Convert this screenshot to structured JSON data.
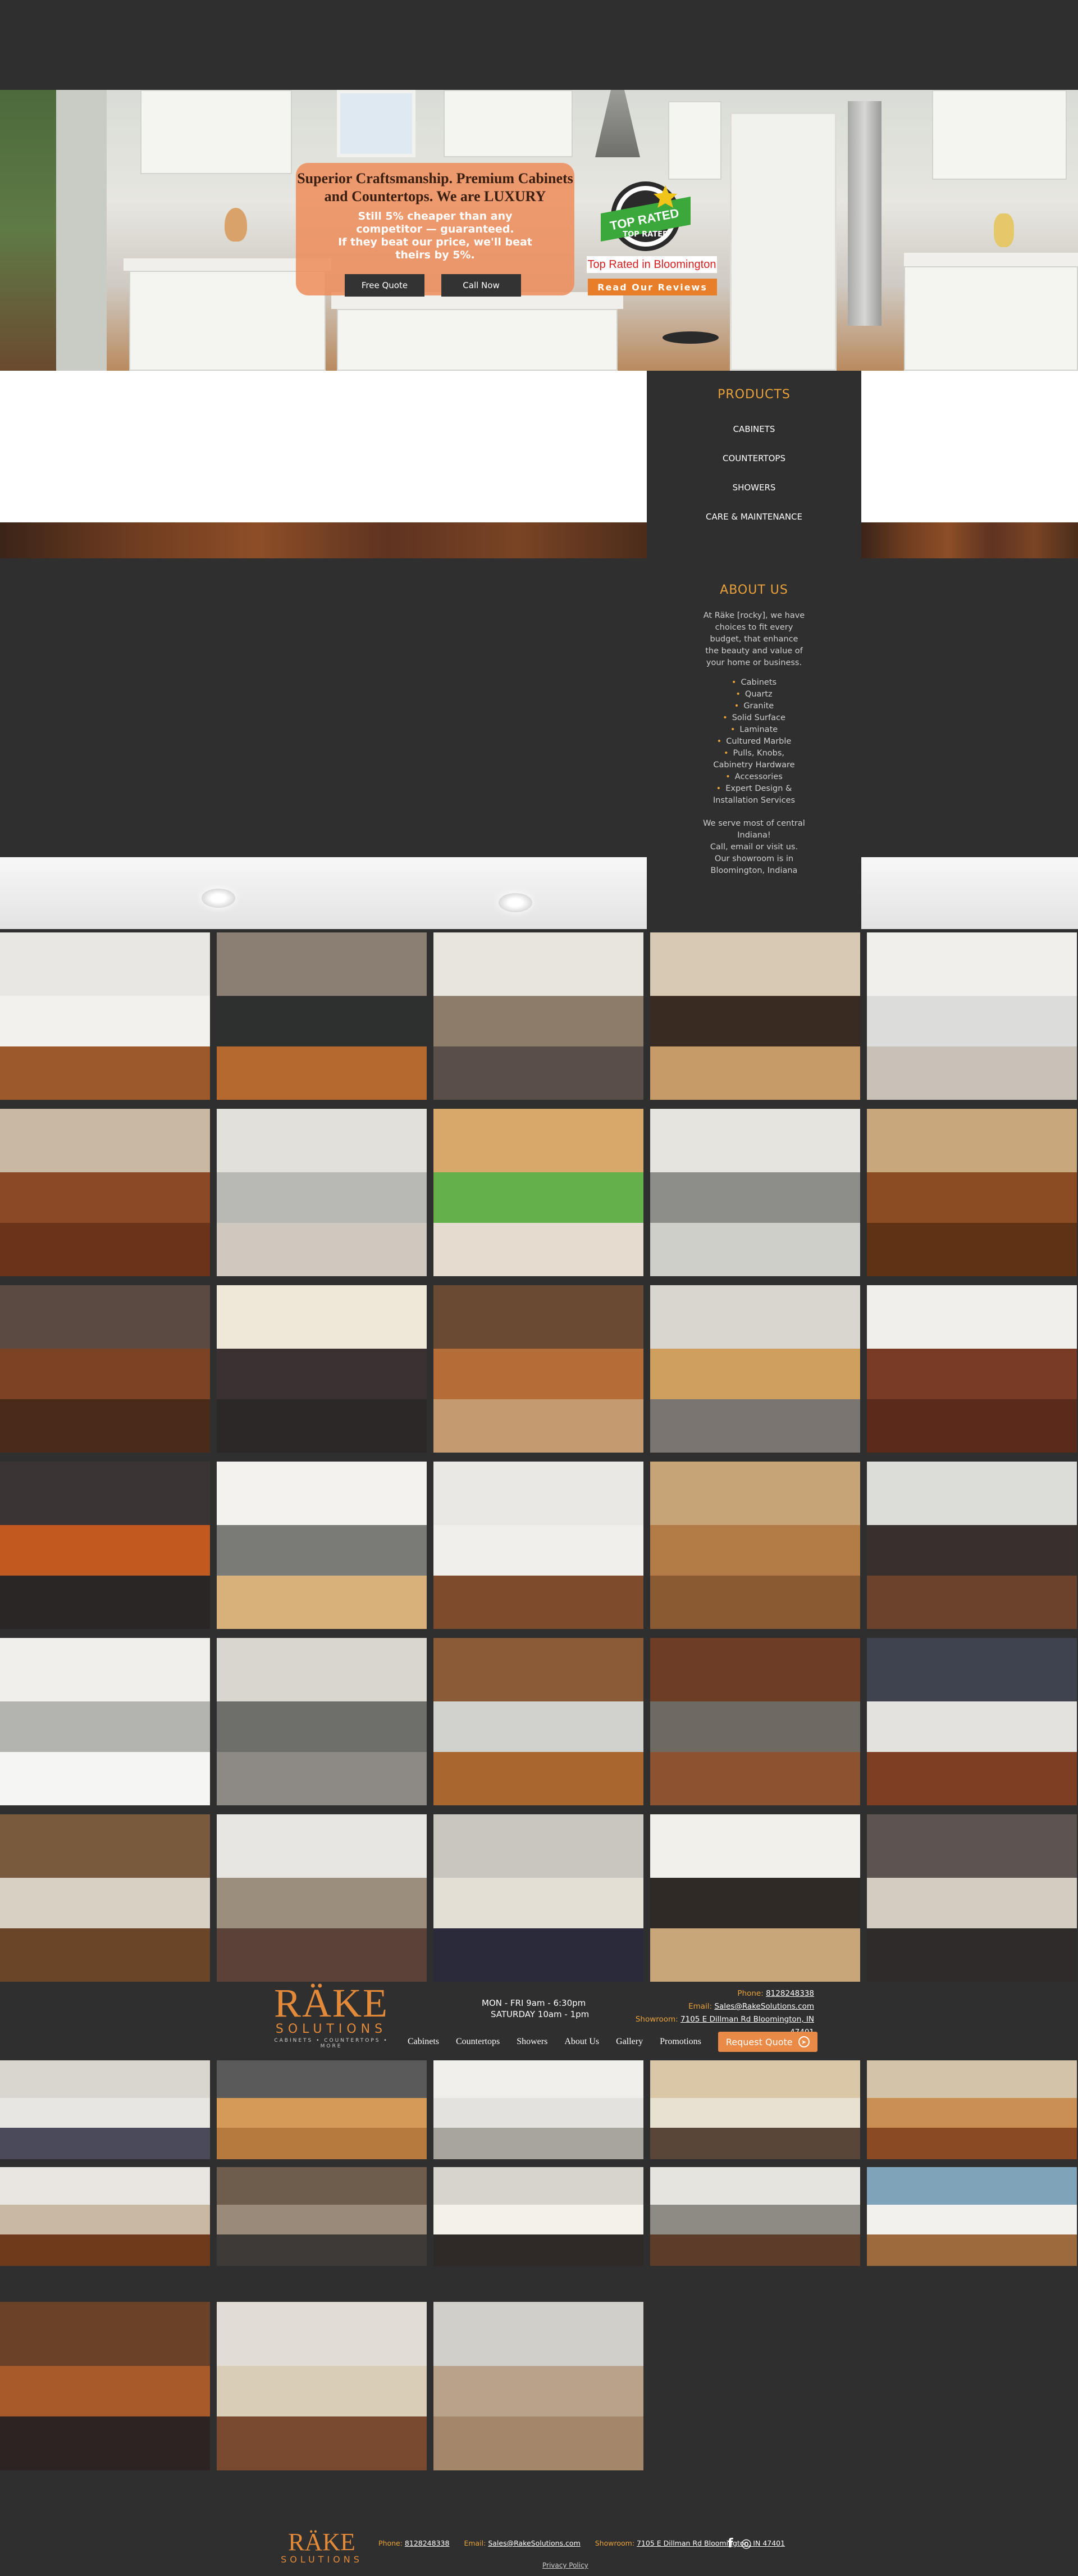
{
  "hero": {
    "headline_line1": "Superior Craftsmanship.  Premium Cabinets",
    "headline_line2": "and Countertops.  We are LUXURY",
    "sub_line1": "Still 5% cheaper than any",
    "sub_line2": "competitor — guaranteed.",
    "sub_line3": "If they beat our price, we'll beat",
    "sub_line4": "theirs by 5%.",
    "free_quote_label": "Free Quote",
    "call_now_label": "Call Now",
    "badge_text_top": "TOP RATED",
    "badge_text_bottom": "TOP RATED",
    "top_rated_label": "Top Rated in Bloomington",
    "reviews_label": "Read Our Reviews"
  },
  "products": {
    "heading": "PRODUCTS",
    "items": [
      "CABINETS",
      "COUNTERTOPS",
      "SHOWERS",
      "CARE & MAINTENANCE"
    ]
  },
  "about": {
    "heading": "ABOUT US",
    "intro": "At Räke [rocky], we have choices to fit every budget, that enhance the beauty and value of your home or business.",
    "list": [
      "Cabinets",
      "Quartz",
      "Granite",
      "Solid Surface",
      "Laminate",
      "Cultured Marble",
      "Pulls, Knobs,"
    ],
    "hardware_line": "Cabinetry Hardware",
    "list2": [
      "Accessories",
      "Expert Design &"
    ],
    "install_line": "Installation Services",
    "serve_line1": "We serve most of central",
    "serve_line2": "Indiana!",
    "serve_line3": "Call, email or visit us.",
    "serve_line4": "Our showroom is in",
    "serve_line5": "Bloomington, Indiana"
  },
  "footer": {
    "logo_text": "RÄKE",
    "logo_sub": "SOLUTIONS",
    "logo_tag": "CABINETS • COUNTERTOPS • MORE",
    "hours_line1": "MON - FRI   9am - 6:30pm",
    "hours_line2": "SATURDAY  10am - 1pm",
    "phone_label": "Phone:",
    "phone_value": "8128248338",
    "email_label": "Email:",
    "email_value": "Sales@RakeSolutions.com",
    "showroom_label": "Showroom:",
    "showroom_value": "7105 E Dillman Rd Bloomington, IN 47401",
    "nav": [
      "Cabinets",
      "Countertops",
      "Showers",
      "About Us",
      "Gallery",
      "Promotions"
    ],
    "request_quote_label": "Request Quote"
  },
  "bottom": {
    "logo_text": "RÄKE",
    "logo_sub": "SOLUTIONS",
    "phone_label": "Phone:",
    "phone_value": "8128248338",
    "email_label": "Email:",
    "email_value": "Sales@RakeSolutions.com",
    "showroom_label": "Showroom:",
    "showroom_value": "7105 E Dillman Rd Bloomington, IN 47401",
    "privacy_label": "Privacy Policy",
    "social": [
      "f",
      "◎"
    ]
  },
  "colors": {
    "background": "#2f2f2f",
    "accent": "#e9a23b",
    "brand_orange": "#e28a3a",
    "promo_box": "#ee8c5a",
    "reviews_button": "#e87e2a"
  },
  "gallery_tiles": [
    {
      "top": "#e9e7e3",
      "mid": "#f2f1ee",
      "bottom": "#9c5a2c"
    },
    {
      "top": "#8a7f72",
      "mid": "#2e2f2f",
      "bottom": "#b5692f"
    },
    {
      "top": "#e8e5df",
      "mid": "#8e7c6a",
      "bottom": "#5a4f48"
    },
    {
      "top": "#d8c9b3",
      "mid": "#3a2b22",
      "bottom": "#c79b68"
    },
    {
      "top": "#f0efec",
      "mid": "#dcdcda",
      "bottom": "#c7c1b8"
    },
    {
      "top": "#c9b9a3",
      "mid": "#8b4a25",
      "bottom": "#6b3319"
    },
    {
      "top": "#e2e0db",
      "mid": "#b8b8b4",
      "bottom": "#cfc8bf"
    },
    {
      "top": "#d8a86a",
      "mid": "#64b04a",
      "bottom": "#e5dbcf"
    },
    {
      "top": "#e6e4df",
      "mid": "#8d8d89",
      "bottom": "#cfcfc9"
    },
    {
      "top": "#c8a77c",
      "mid": "#8b4c22",
      "bottom": "#5f3115"
    },
    {
      "top": "#5a4a42",
      "mid": "#7b4324",
      "bottom": "#4a2a18"
    },
    {
      "top": "#efe8d8",
      "mid": "#3a3232",
      "bottom": "#2d2828"
    },
    {
      "top": "#6b4a34",
      "mid": "#b46d36",
      "bottom": "#c49b70"
    },
    {
      "top": "#d9d6d0",
      "mid": "#cf9f5e",
      "bottom": "#7a7570"
    },
    {
      "top": "#f0efec",
      "mid": "#7a3b26",
      "bottom": "#5b2a1a"
    },
    {
      "top": "#3a3434",
      "mid": "#c25a20",
      "bottom": "#2a2626"
    },
    {
      "top": "#f3f2ef",
      "mid": "#7a7a76",
      "bottom": "#d8b07a"
    },
    {
      "top": "#e9e8e4",
      "mid": "#f0efec",
      "bottom": "#7e4b2c"
    },
    {
      "top": "#c7a378",
      "mid": "#b37b46",
      "bottom": "#8a5a32"
    },
    {
      "top": "#dcdcd9",
      "mid": "#38302d",
      "bottom": "#6b432c"
    },
    {
      "top": "#f0efec",
      "mid": "#b3b3b0",
      "bottom": "#f5f5f3"
    },
    {
      "top": "#d9d6d0",
      "mid": "#6e6e6b",
      "bottom": "#8d8a85"
    },
    {
      "top": "#8b5a36",
      "mid": "#d1d1cd",
      "bottom": "#a9662e"
    },
    {
      "top": "#6d3e25",
      "mid": "#6e6a62",
      "bottom": "#8b5330"
    },
    {
      "top": "#3f4350",
      "mid": "#e3e2de",
      "bottom": "#7d3e24"
    },
    {
      "top": "#7a5a3c",
      "mid": "#d8d0c3",
      "bottom": "#6b4528"
    },
    {
      "top": "#e8e6e2",
      "mid": "#9c8e7c",
      "bottom": "#5a4238"
    },
    {
      "top": "#c9c5bf",
      "mid": "#e4dfd5",
      "bottom": "#2a2a3a"
    },
    {
      "top": "#f2f0eb",
      "mid": "#2f2a26",
      "bottom": "#c9a57a"
    },
    {
      "top": "#5b5450",
      "mid": "#d3ccc0",
      "bottom": "#2f2b2a"
    }
  ],
  "bottom_tiles": [
    {
      "top": "#d9d6d0",
      "mid": "#e8e6e2",
      "bottom": "#4a4a5a"
    },
    {
      "top": "#5a5a5a",
      "mid": "#d59a58",
      "bottom": "#b67a3e"
    },
    {
      "top": "#f0efec",
      "mid": "#e4e2de",
      "bottom": "#a8a49e"
    },
    {
      "top": "#d9c7a8",
      "mid": "#e8e0d0",
      "bottom": "#5a4638"
    },
    {
      "top": "#d3c3a8",
      "mid": "#c98f55",
      "bottom": "#8a4a23"
    },
    {
      "top": "#e9e6e1",
      "mid": "#c9b9a3",
      "bottom": "#6f3a1c"
    },
    {
      "top": "#6e5d4c",
      "mid": "#9a8a7a",
      "bottom": "#3e3a38"
    },
    {
      "top": "#d7d4ce",
      "mid": "#f3f1ea",
      "bottom": "#2f2927"
    },
    {
      "top": "#e6e4df",
      "mid": "#8e8a84",
      "bottom": "#5e3c2a"
    },
    {
      "top": "#7fa3b8",
      "mid": "#f2f1ee",
      "bottom": "#9c6a3c"
    },
    {
      "top": "#6a4228",
      "mid": "#a85a2a",
      "bottom": "#2d2322"
    },
    {
      "top": "#e1ddd4",
      "mid": "#d9cdb8",
      "bottom": "#7a4a30"
    },
    {
      "top": "#d0cfca",
      "mid": "#b8a28a",
      "bottom": "#a4866a"
    }
  ]
}
